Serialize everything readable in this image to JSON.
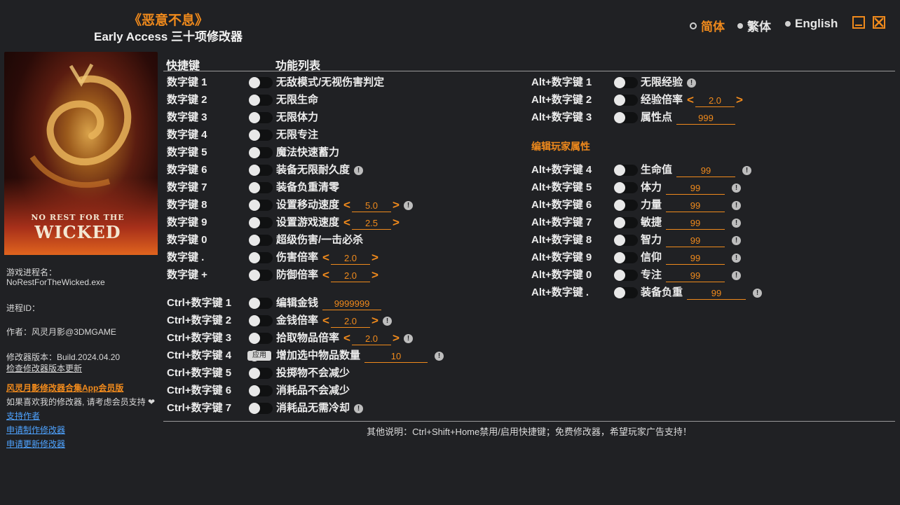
{
  "header": {
    "game_title": "《恶意不息》",
    "subtitle": "Early Access 三十项修改器"
  },
  "languages": [
    {
      "label": "简体",
      "active": true
    },
    {
      "label": "繁体",
      "active": false
    },
    {
      "label": "English",
      "active": false
    }
  ],
  "cover": {
    "logo_small": "NO REST FOR THE",
    "logo_big": "WICKED"
  },
  "sidebar": {
    "process_label": "游戏进程名：",
    "process_value": "NoRestForTheWicked.exe",
    "pid_label": "进程ID：",
    "author": "作者：风灵月影@3DMGAME",
    "version": "修改器版本：Build.2024.04.20",
    "check_update": "检查修改器版本更新",
    "app_link": "风灵月影修改器合集App会员版",
    "support_text": "如果喜欢我的修改器, 请考虑会员支持",
    "links": [
      "支持作者",
      "申请制作修改器",
      "申请更新修改器"
    ]
  },
  "columns": {
    "hotkey": "快捷键",
    "features": "功能列表"
  },
  "left_rows": [
    {
      "key": "数字键 1",
      "label": "无敌模式/无视伤害判定"
    },
    {
      "key": "数字键 2",
      "label": "无限生命"
    },
    {
      "key": "数字键 3",
      "label": "无限体力"
    },
    {
      "key": "数字键 4",
      "label": "无限专注"
    },
    {
      "key": "数字键 5",
      "label": "魔法快速蓄力"
    },
    {
      "key": "数字键 6",
      "label": "装备无限耐久度",
      "info": true
    },
    {
      "key": "数字键 7",
      "label": "装备负重清零"
    },
    {
      "key": "数字键 8",
      "label": "设置移动速度",
      "value": "5.0",
      "arrows": true,
      "info": true
    },
    {
      "key": "数字键 9",
      "label": "设置游戏速度",
      "value": "2.5",
      "arrows": true
    },
    {
      "key": "数字键 0",
      "label": "超级伤害/一击必杀"
    },
    {
      "key": "数字键 .",
      "label": "伤害倍率",
      "value": "2.0",
      "arrows": true
    },
    {
      "key": "数字键 +",
      "label": "防御倍率",
      "value": "2.0",
      "arrows": true
    },
    {
      "key": "Ctrl+数字键 1",
      "label": "编辑金钱",
      "value": "9999999"
    },
    {
      "key": "Ctrl+数字键 2",
      "label": "金钱倍率",
      "value": "2.0",
      "arrows": true,
      "info": true
    },
    {
      "key": "Ctrl+数字键 3",
      "label": "拾取物品倍率",
      "value": "2.0",
      "arrows": true,
      "info": true
    },
    {
      "key": "Ctrl+数字键 4",
      "label": "增加选中物品数量",
      "value": "10",
      "apply": "应用",
      "info": true
    },
    {
      "key": "Ctrl+数字键 5",
      "label": "投掷物不会减少"
    },
    {
      "key": "Ctrl+数字键 6",
      "label": "消耗品不会减少"
    },
    {
      "key": "Ctrl+数字键 7",
      "label": "消耗品无需冷却",
      "info": true
    }
  ],
  "right_rows": [
    {
      "key": "Alt+数字键 1",
      "label": "无限经验",
      "info": true
    },
    {
      "key": "Alt+数字键 2",
      "label": "经验倍率",
      "value": "2.0",
      "arrows": true
    },
    {
      "key": "Alt+数字键 3",
      "label": "属性点",
      "value": "999"
    }
  ],
  "section_title": "编辑玩家属性",
  "attr_rows": [
    {
      "key": "Alt+数字键 4",
      "label": "生命值",
      "value": "99",
      "info": true
    },
    {
      "key": "Alt+数字键 5",
      "label": "体力",
      "value": "99",
      "info": true
    },
    {
      "key": "Alt+数字键 6",
      "label": "力量",
      "value": "99",
      "info": true
    },
    {
      "key": "Alt+数字键 7",
      "label": "敏捷",
      "value": "99",
      "info": true
    },
    {
      "key": "Alt+数字键 8",
      "label": "智力",
      "value": "99",
      "info": true
    },
    {
      "key": "Alt+数字键 9",
      "label": "信仰",
      "value": "99",
      "info": true
    },
    {
      "key": "Alt+数字键 0",
      "label": "专注",
      "value": "99",
      "info": true
    },
    {
      "key": "Alt+数字键 .",
      "label": "装备负重",
      "value": "99",
      "info": true
    }
  ],
  "footer": "其他说明：Ctrl+Shift+Home禁用/启用快捷键；免费修改器，希望玩家广告支持！",
  "colors": {
    "accent": "#f08a1c",
    "background": "#202124",
    "link": "#4ea3ff"
  }
}
